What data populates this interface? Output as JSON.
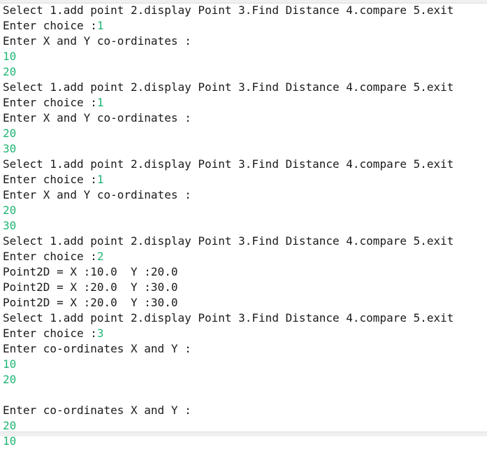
{
  "console": {
    "lines": [
      {
        "text": "Select 1.add point 2.display Point 3.Find Distance 4.compare 5.exit",
        "input": ""
      },
      {
        "text": "Enter choice :",
        "input": "1"
      },
      {
        "text": "Enter X and Y co-ordinates :",
        "input": ""
      },
      {
        "text": "",
        "input": "10"
      },
      {
        "text": "",
        "input": "20"
      },
      {
        "text": "Select 1.add point 2.display Point 3.Find Distance 4.compare 5.exit",
        "input": ""
      },
      {
        "text": "Enter choice :",
        "input": "1"
      },
      {
        "text": "Enter X and Y co-ordinates :",
        "input": ""
      },
      {
        "text": "",
        "input": "20"
      },
      {
        "text": "",
        "input": "30"
      },
      {
        "text": "Select 1.add point 2.display Point 3.Find Distance 4.compare 5.exit",
        "input": ""
      },
      {
        "text": "Enter choice :",
        "input": "1"
      },
      {
        "text": "Enter X and Y co-ordinates :",
        "input": ""
      },
      {
        "text": "",
        "input": "20"
      },
      {
        "text": "",
        "input": "30"
      },
      {
        "text": "Select 1.add point 2.display Point 3.Find Distance 4.compare 5.exit",
        "input": ""
      },
      {
        "text": "Enter choice :",
        "input": "2"
      },
      {
        "text": "Point2D = X :10.0  Y :20.0",
        "input": ""
      },
      {
        "text": "Point2D = X :20.0  Y :30.0",
        "input": ""
      },
      {
        "text": "Point2D = X :20.0  Y :30.0",
        "input": ""
      },
      {
        "text": "Select 1.add point 2.display Point 3.Find Distance 4.compare 5.exit",
        "input": ""
      },
      {
        "text": "Enter choice :",
        "input": "3"
      },
      {
        "text": "Enter co-ordinates X and Y :",
        "input": ""
      },
      {
        "text": "",
        "input": "10"
      },
      {
        "text": "",
        "input": "20"
      },
      {
        "text": "",
        "input": ""
      },
      {
        "text": "Enter co-ordinates X and Y :",
        "input": ""
      },
      {
        "text": "",
        "input": "20"
      },
      {
        "text": "",
        "input": "10"
      }
    ]
  },
  "colors": {
    "output_text": "#1a1a1a",
    "user_input": "#21b573",
    "background": "#ffffff"
  }
}
